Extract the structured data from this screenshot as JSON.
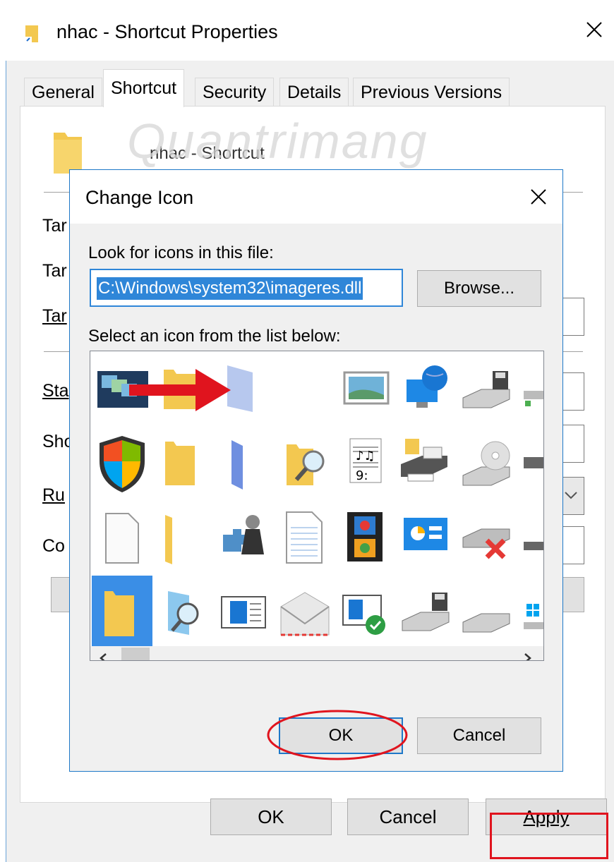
{
  "outer": {
    "title": "nhac - Shortcut Properties",
    "tabs": [
      "General",
      "Shortcut",
      "Security",
      "Details",
      "Previous Versions"
    ],
    "active_tab": "Shortcut",
    "shortcut_name": "nhac - Shortcut",
    "field_labels": [
      "Tar",
      "Tar",
      "Tar",
      "Sta",
      "Sho",
      "Ru",
      "Co"
    ],
    "buttons": {
      "ok": "OK",
      "cancel": "Cancel",
      "apply": "Apply"
    }
  },
  "watermark": "Quantrimang",
  "dialog": {
    "title": "Change Icon",
    "look_label": "Look for icons in this file:",
    "path_value": "C:\\Windows\\system32\\imageres.dll",
    "browse_label": "Browse...",
    "select_label": "Select an icon from the list below:",
    "ok_label": "OK",
    "cancel_label": "Cancel"
  },
  "icons": [
    [
      "multi-window-icon",
      "folder-icon",
      "blue-folder-icon",
      "blank-icon",
      "picture-icon",
      "globe-computer-icon",
      "floppy-drive-icon",
      "network-drive-icon"
    ],
    [
      "windows-shield-icon",
      "folder-icon",
      "blue-folder-icon",
      "folder-search-icon",
      "music-sheet-icon",
      "printer-icon",
      "cd-drive-icon",
      "drive-icon"
    ],
    [
      "blank-document-icon",
      "folder-icon",
      "games-icon",
      "lined-document-icon",
      "film-icon",
      "control-panel-icon",
      "disconnected-drive-icon",
      "drive-icon"
    ],
    [
      "folder-icon",
      "search-icon",
      "window-icon",
      "mail-envelope-icon",
      "checked-window-icon",
      "floppy-drive-icon",
      "drive-icon",
      "windows-drive-icon"
    ]
  ],
  "selected_icon": "folder-icon",
  "colors": {
    "accent": "#3a8ee6",
    "annotation_red": "#e0141e",
    "folder_yellow": "#f3c850"
  }
}
